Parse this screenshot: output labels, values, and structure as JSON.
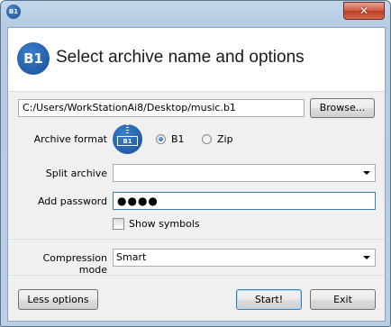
{
  "titlebar": {
    "icon_text": "B1",
    "close_glyph": "✕"
  },
  "header": {
    "logo_text": "B1",
    "title": "Select archive name and options"
  },
  "destination": {
    "path": "C:/Users/WorkStationAi8/Desktop/music.b1",
    "browse_label": "Browse..."
  },
  "format": {
    "label": "Archive format",
    "icon_text": "B1",
    "options": [
      {
        "label": "B1",
        "selected": true
      },
      {
        "label": "Zip",
        "selected": false
      }
    ]
  },
  "split": {
    "label": "Split archive",
    "value": ""
  },
  "password": {
    "label": "Add password",
    "masked_value": "●●●●",
    "show_symbols_label": "Show symbols",
    "show_symbols_checked": false
  },
  "compression": {
    "label": "Compression mode",
    "value": "Smart"
  },
  "footer": {
    "less_options_label": "Less options",
    "start_label": "Start!",
    "exit_label": "Exit"
  },
  "colors": {
    "accent": "#1d4f8f",
    "close": "#c7452b"
  }
}
